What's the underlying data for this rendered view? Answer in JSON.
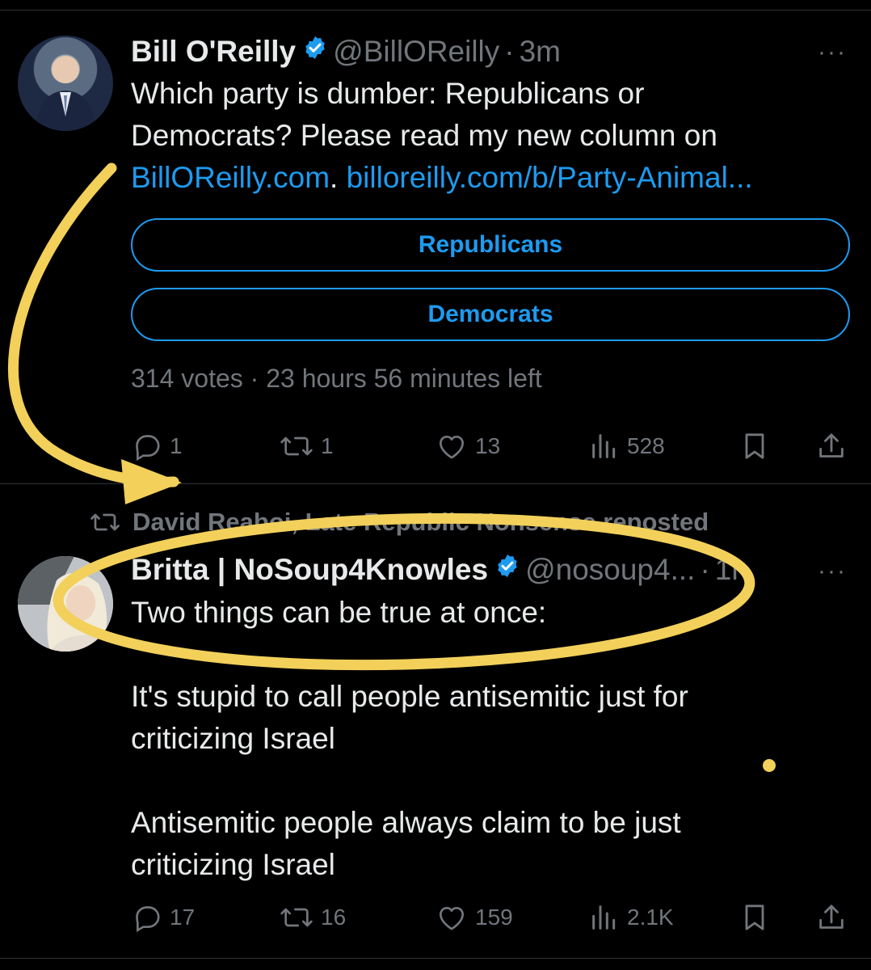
{
  "tweet1": {
    "display_name": "Bill O'Reilly",
    "handle": "@BillOReilly",
    "separator": "·",
    "time": "3m",
    "more": "···",
    "text_line1": "Which party is dumber: Republicans or",
    "text_line2": "Democrats?  Please read my new column on",
    "link1": "BillOReilly.com",
    "link_sep": ".",
    "link2": "billoreilly.com/b/Party-Animal...",
    "poll": {
      "options": [
        "Republicans",
        "Democrats"
      ],
      "votes": "314 votes",
      "separator": "·",
      "time_left": "23 hours 56 minutes left"
    },
    "actions": {
      "replies": "1",
      "reposts": "1",
      "likes": "13",
      "views": "528"
    }
  },
  "tweet2": {
    "repost_notice": "David Reaboi, Late Republic Nonsense reposted",
    "display_name": "Britta | NoSoup4Knowles",
    "handle": "@nosoup4...",
    "separator": "·",
    "time": "1h",
    "more": "···",
    "line1": "Two things can be true at once:",
    "line2": "It's stupid to call people antisemitic just for",
    "line3": "criticizing Israel",
    "line4": "Antisemitic people always claim to be just",
    "line5": "criticizing Israel",
    "actions": {
      "replies": "17",
      "reposts": "16",
      "likes": "159",
      "views": "2.1K"
    }
  },
  "colors": {
    "background": "#000000",
    "text": "#e7e9ea",
    "muted": "#71767b",
    "link": "#1d9bf0",
    "annotation": "#f2d05a"
  },
  "icons": [
    "reply-icon",
    "repost-icon",
    "like-icon",
    "views-icon",
    "bookmark-icon",
    "share-icon",
    "verified-badge-icon",
    "more-icon"
  ]
}
